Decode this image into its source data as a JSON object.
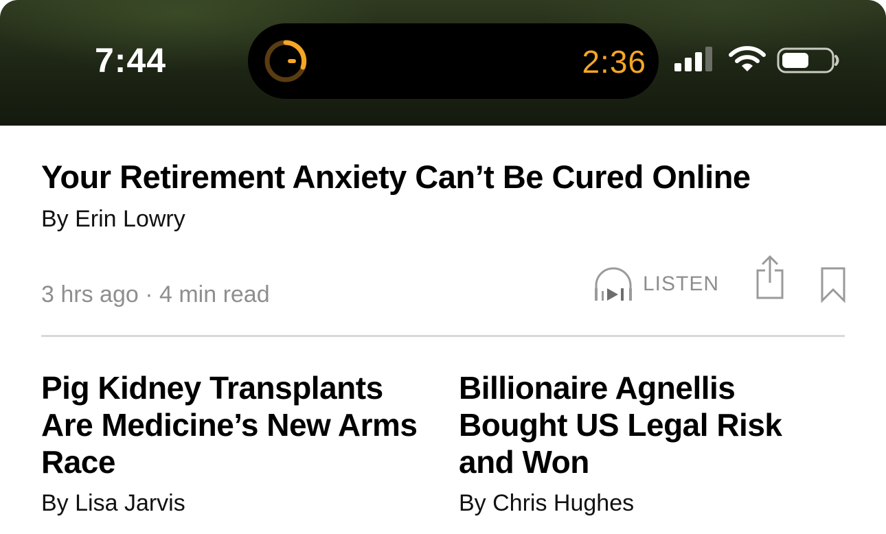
{
  "status_bar": {
    "time": "7:44",
    "timer": "2:36",
    "timer_color": "#f5a623",
    "icons": [
      "timer-icon",
      "signal-icon",
      "wifi-icon",
      "battery-icon"
    ]
  },
  "lead_story": {
    "title": "Your Retirement Anxiety Can’t Be Cured Online",
    "author": "By Erin Lowry",
    "meta": "3 hrs ago · 4 min read",
    "listen_label": "LISTEN",
    "actions": [
      "headphones-play-icon",
      "share-icon",
      "bookmark-icon"
    ]
  },
  "stories": [
    {
      "title": "Pig Kidney Transplants Are Medicine’s New Arms Race",
      "author": "By Lisa Jarvis"
    },
    {
      "title": "Billionaire Agnellis Bought US Legal Risk and Won",
      "author": "By Chris Hughes"
    }
  ]
}
